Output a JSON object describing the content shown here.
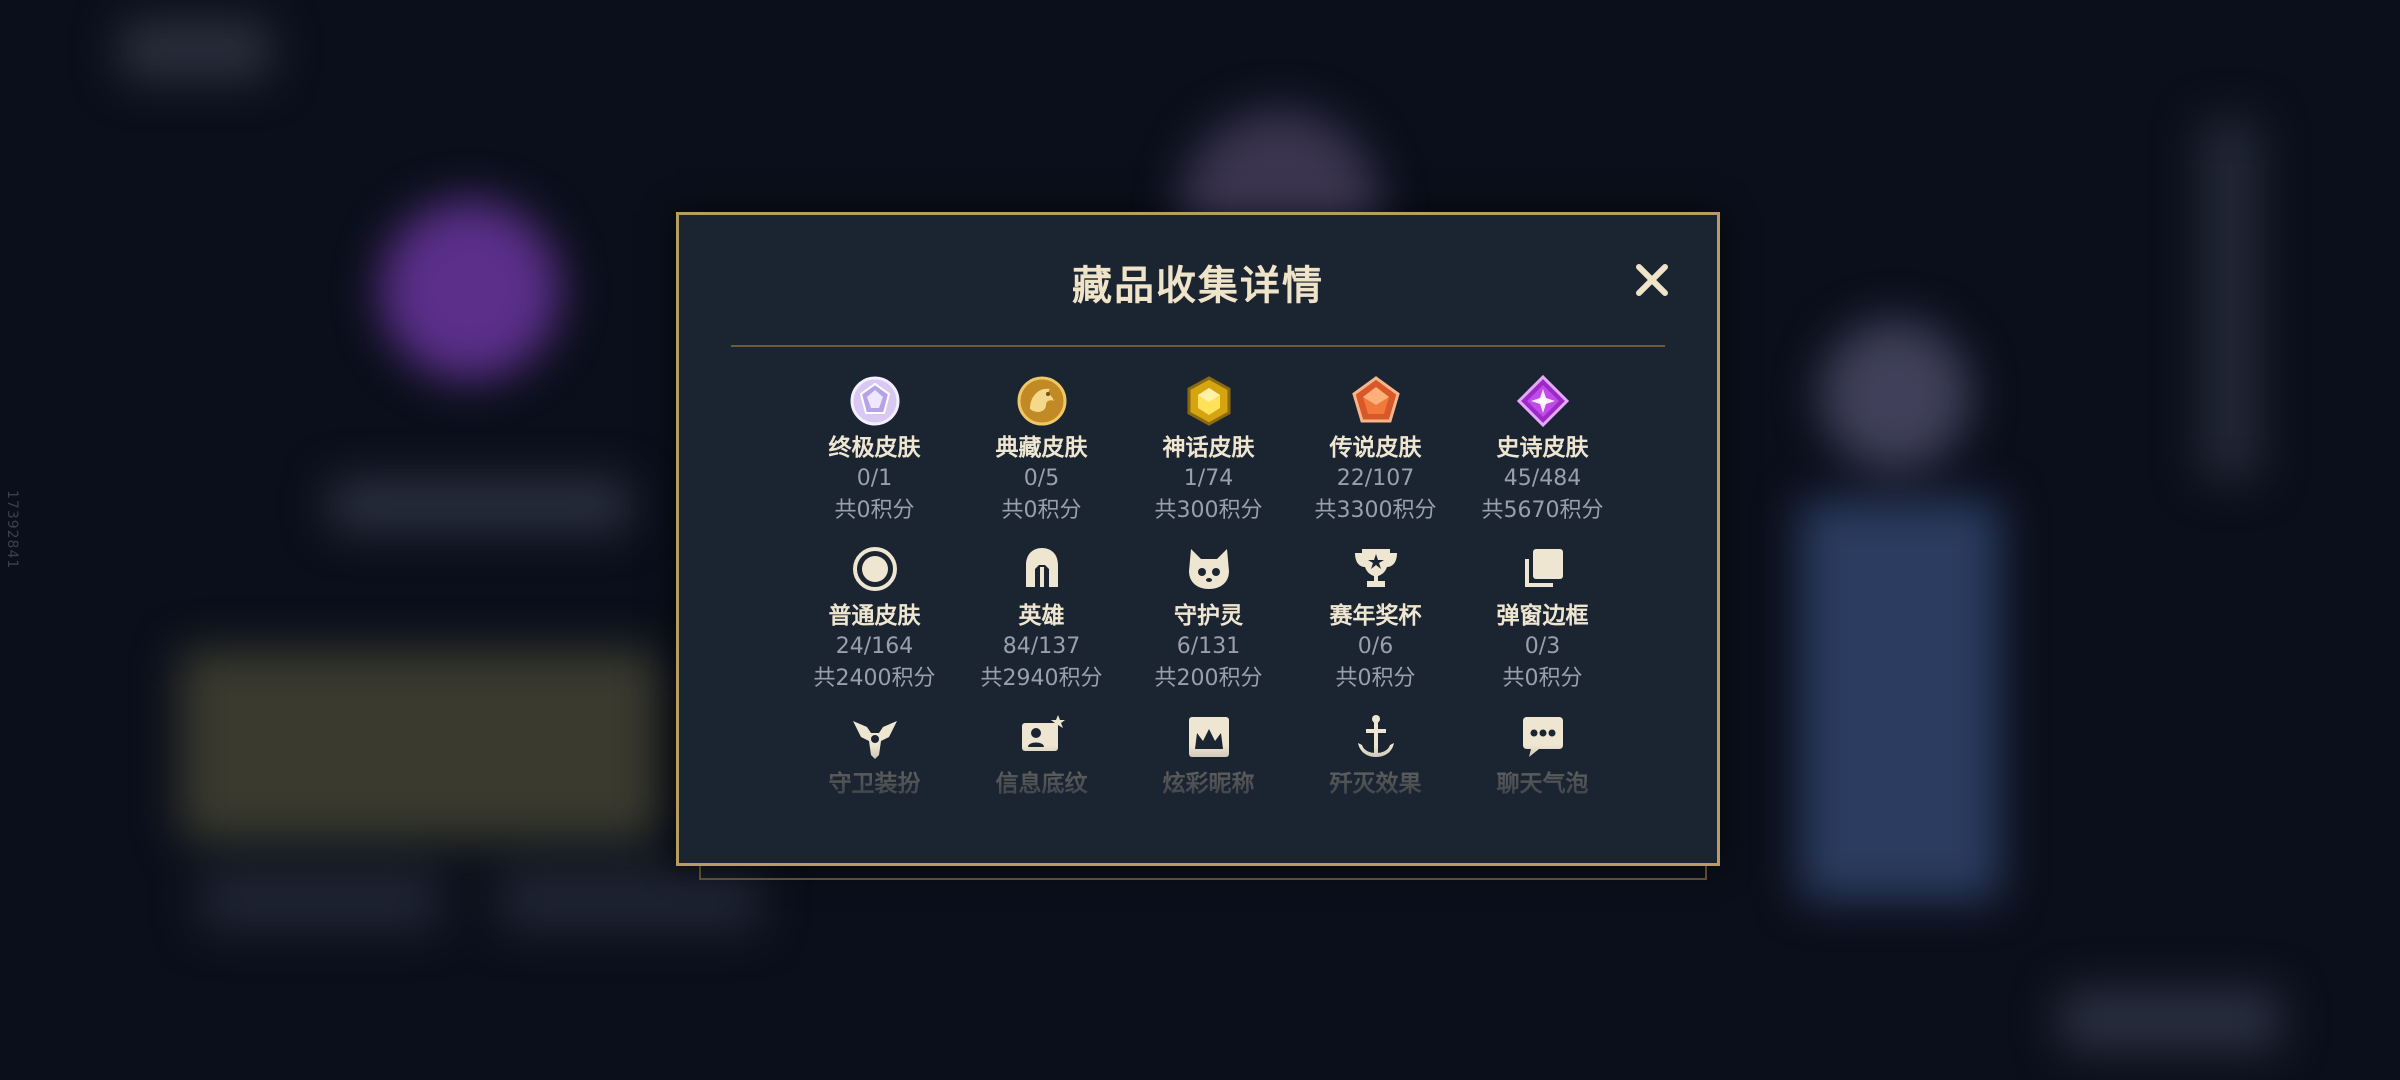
{
  "modal": {
    "title": "藏品收集详情"
  },
  "side_text": "17392841",
  "collections": [
    {
      "name": "终极皮肤",
      "count": "0/1",
      "points": "共0积分",
      "icon": "ultimate-skin-icon"
    },
    {
      "name": "典藏皮肤",
      "count": "0/5",
      "points": "共0积分",
      "icon": "prestige-skin-icon"
    },
    {
      "name": "神话皮肤",
      "count": "1/74",
      "points": "共300积分",
      "icon": "mythic-skin-icon"
    },
    {
      "name": "传说皮肤",
      "count": "22/107",
      "points": "共3300积分",
      "icon": "legendary-skin-icon"
    },
    {
      "name": "史诗皮肤",
      "count": "45/484",
      "points": "共5670积分",
      "icon": "epic-skin-icon"
    },
    {
      "name": "普通皮肤",
      "count": "24/164",
      "points": "共2400积分",
      "icon": "standard-skin-icon"
    },
    {
      "name": "英雄",
      "count": "84/137",
      "points": "共2940积分",
      "icon": "champion-helmet-icon"
    },
    {
      "name": "守护灵",
      "count": "6/131",
      "points": "共200积分",
      "icon": "guardian-spirit-icon"
    },
    {
      "name": "赛年奖杯",
      "count": "0/6",
      "points": "共0积分",
      "icon": "trophy-icon"
    },
    {
      "name": "弹窗边框",
      "count": "0/3",
      "points": "共0积分",
      "icon": "popup-frame-icon"
    },
    {
      "name": "守卫装扮",
      "icon": "ward-skin-icon"
    },
    {
      "name": "信息底纹",
      "icon": "info-background-icon"
    },
    {
      "name": "炫彩昵称",
      "icon": "colorful-nickname-icon"
    },
    {
      "name": "歼灭效果",
      "icon": "elimination-effect-icon"
    },
    {
      "name": "聊天气泡",
      "icon": "chat-bubble-icon"
    }
  ],
  "colors": {
    "gold_border": "#b79d62",
    "modal_bg": "#1b2431",
    "title_text": "#efe3c8",
    "muted_text": "#9aa0aa"
  }
}
